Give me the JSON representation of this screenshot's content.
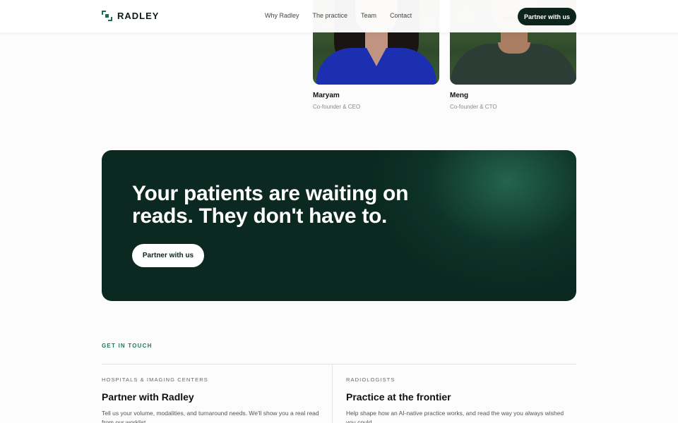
{
  "header": {
    "logo_text": "RADLEY",
    "nav": [
      "Why Radley",
      "The practice",
      "Team",
      "Contact"
    ],
    "cta_label": "Partner with us"
  },
  "team": [
    {
      "name": "Maryam",
      "role": "Co-founder & CEO"
    },
    {
      "name": "Meng",
      "role": "Co-founder & CTO"
    }
  ],
  "cta_banner": {
    "title": "Your patients are waiting on reads. They don't have to.",
    "button_label": "Partner with us"
  },
  "contact": {
    "eyebrow": "GET IN TOUCH",
    "columns": [
      {
        "label": "HOSPITALS & IMAGING CENTERS",
        "title": "Partner with Radley",
        "body": "Tell us your volume, modalities, and turnaround needs. We'll show you a real read from our worklist."
      },
      {
        "label": "RADIOLOGISTS",
        "title": "Practice at the frontier",
        "body": "Help shape how an AI-native practice works, and read the way you always wished you could."
      }
    ]
  },
  "colors": {
    "brand_dark": "#0c241c",
    "brand_green": "#1f7a5a"
  }
}
